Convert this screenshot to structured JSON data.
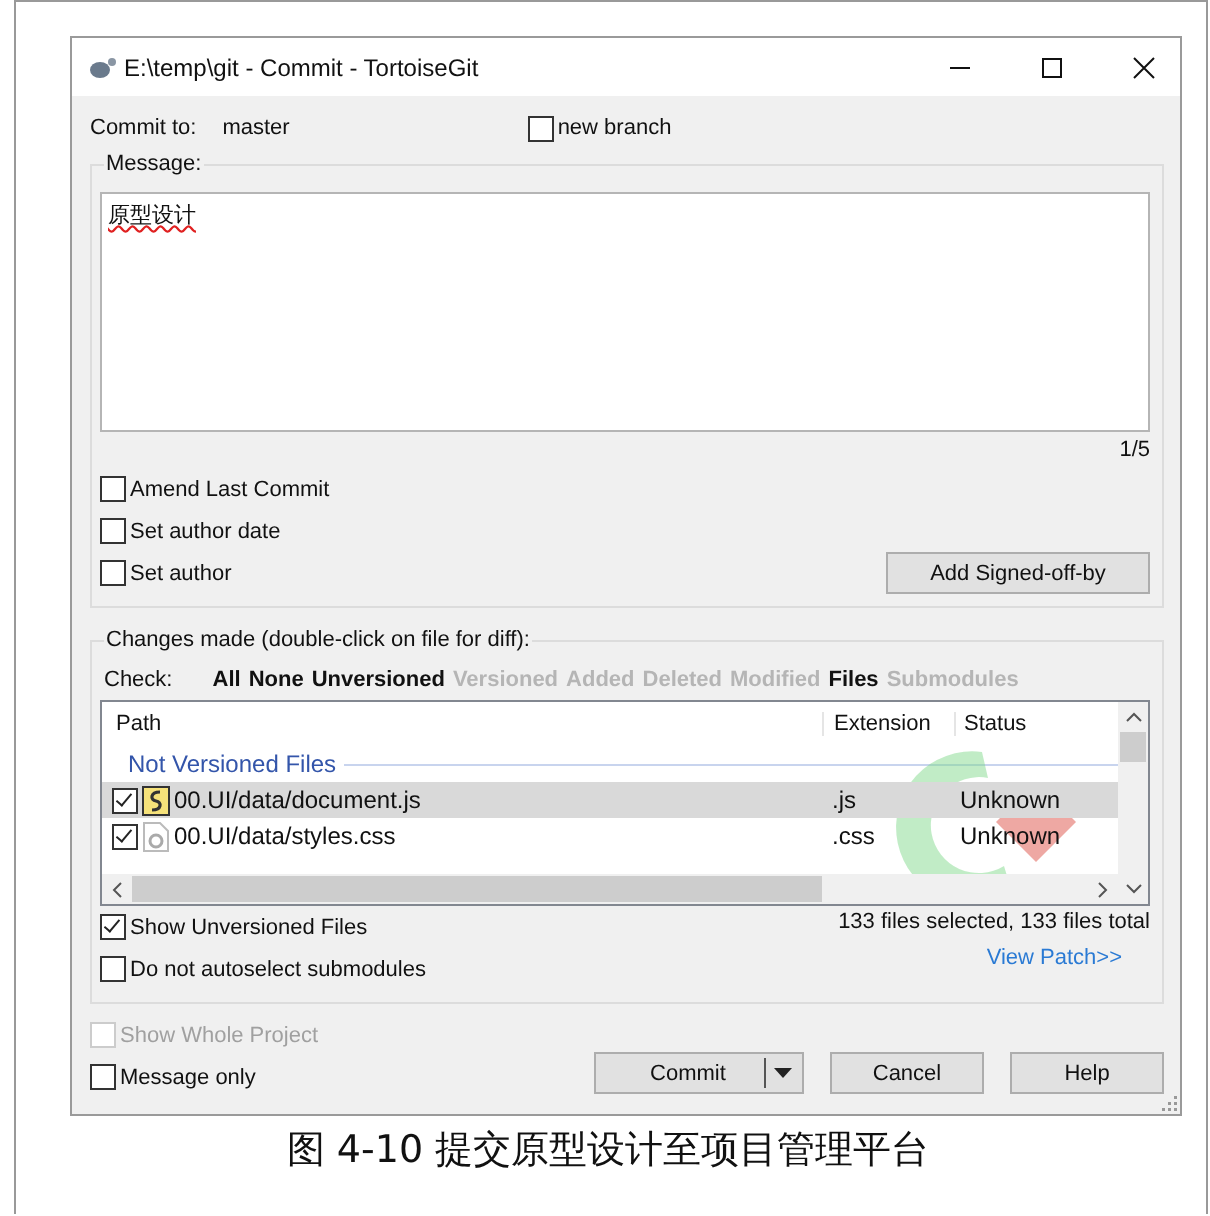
{
  "window": {
    "title": "E:\\temp\\git - Commit - TortoiseGit"
  },
  "commit_to": {
    "label": "Commit to:",
    "branch": "master",
    "new_branch": {
      "label": "new branch",
      "checked": false
    }
  },
  "message": {
    "legend": "Message:",
    "value": "原型设计",
    "counter": "1/5",
    "options": [
      {
        "label": "Amend Last Commit",
        "checked": false
      },
      {
        "label": "Set author date",
        "checked": false
      },
      {
        "label": "Set author",
        "checked": false
      }
    ],
    "signoff_button": "Add Signed-off-by"
  },
  "changes": {
    "legend": "Changes made (double-click on file for diff):",
    "check_label": "Check:",
    "filters": [
      {
        "label": "All",
        "disabled": false
      },
      {
        "label": "None",
        "disabled": false
      },
      {
        "label": "Unversioned",
        "disabled": false
      },
      {
        "label": "Versioned",
        "disabled": true
      },
      {
        "label": "Added",
        "disabled": true
      },
      {
        "label": "Deleted",
        "disabled": true
      },
      {
        "label": "Modified",
        "disabled": true
      },
      {
        "label": "Files",
        "disabled": false
      },
      {
        "label": "Submodules",
        "disabled": true
      }
    ],
    "columns": [
      "Path",
      "Extension",
      "Status"
    ],
    "group": "Not Versioned Files",
    "rows": [
      {
        "path": "00.UI/data/document.js",
        "extension": ".js",
        "status": "Unknown",
        "checked": true,
        "selected": true,
        "kind": "script"
      },
      {
        "path": "00.UI/data/styles.css",
        "extension": ".css",
        "status": "Unknown",
        "checked": true,
        "selected": false,
        "kind": "style"
      }
    ],
    "options": [
      {
        "label": "Show Unversioned Files",
        "checked": true
      },
      {
        "label": "Do not autoselect submodules",
        "checked": false
      }
    ],
    "summary": "133 files selected, 133 files total",
    "view_patch": "View Patch>>"
  },
  "footer": {
    "options": [
      {
        "label": "Show Whole Project",
        "checked": false,
        "disabled": true
      },
      {
        "label": "Message only",
        "checked": false,
        "disabled": false
      }
    ],
    "buttons": [
      "Commit",
      "Cancel",
      "Help"
    ]
  },
  "caption": "图 4-10  提交原型设计至项目管理平台"
}
